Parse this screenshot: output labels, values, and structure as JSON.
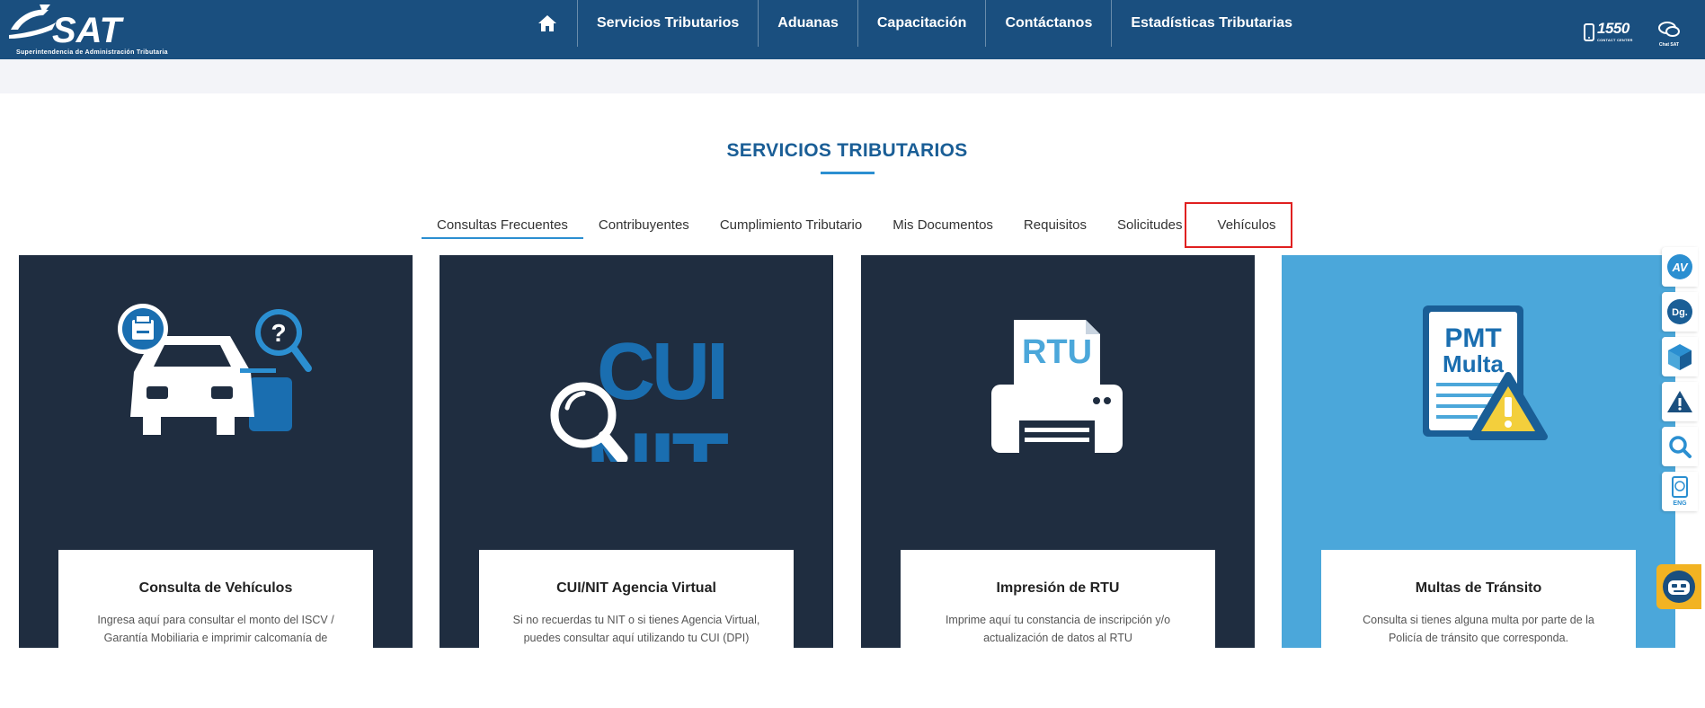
{
  "header": {
    "logo_text": "SAT",
    "logo_subtitle": "Superintendencia de Administración Tributaria",
    "nav": [
      {
        "label": "Servicios Tributarios"
      },
      {
        "label": "Aduanas"
      },
      {
        "label": "Capacitación"
      },
      {
        "label": "Contáctanos"
      },
      {
        "label": "Estadísticas Tributarias"
      }
    ],
    "contact_number": "1550",
    "contact_label": "CONTACT CENTER",
    "chat_label": "Chat SAT"
  },
  "section": {
    "title": "SERVICIOS TRIBUTARIOS"
  },
  "tabs": [
    {
      "label": "Consultas Frecuentes",
      "active": true
    },
    {
      "label": "Contribuyentes"
    },
    {
      "label": "Cumplimiento Tributario"
    },
    {
      "label": "Mis Documentos"
    },
    {
      "label": "Requisitos"
    },
    {
      "label": "Solicitudes"
    },
    {
      "label": "Vehículos"
    }
  ],
  "cards": [
    {
      "title": "Consulta de Vehículos",
      "desc": "Ingresa aquí para consultar el monto del ISCV / Garantía Mobiliaria e imprimir calcomanía de circulación",
      "icon": "car-print-search-icon"
    },
    {
      "title": "CUI/NIT Agencia Virtual",
      "desc": "Si no recuerdas tu NIT o si tienes Agencia Virtual, puedes consultar aquí utilizando tu CUI (DPI)",
      "icon": "cui-nit-search-icon",
      "icon_text_1": "CUI",
      "icon_text_2": "NIT"
    },
    {
      "title": "Impresión de RTU",
      "desc": "Imprime aquí tu constancia de inscripción y/o actualización de datos al RTU",
      "icon": "printer-rtu-icon",
      "icon_text": "RTU"
    },
    {
      "title": "Multas de Tránsito",
      "desc": "Consulta si tienes alguna multa por parte de la Policía de tránsito que corresponda.",
      "icon": "pmt-multa-icon",
      "icon_text_1": "PMT",
      "icon_text_2": "Multa"
    }
  ],
  "side_icons": {
    "av": "AV",
    "dg": "Dg.",
    "eng": "ENG"
  },
  "colors": {
    "header_bg": "#1a4f7f",
    "card_dark": "#1f2d40",
    "card_light": "#4ba7da",
    "accent": "#2b8fd1",
    "highlight": "#e02020"
  }
}
